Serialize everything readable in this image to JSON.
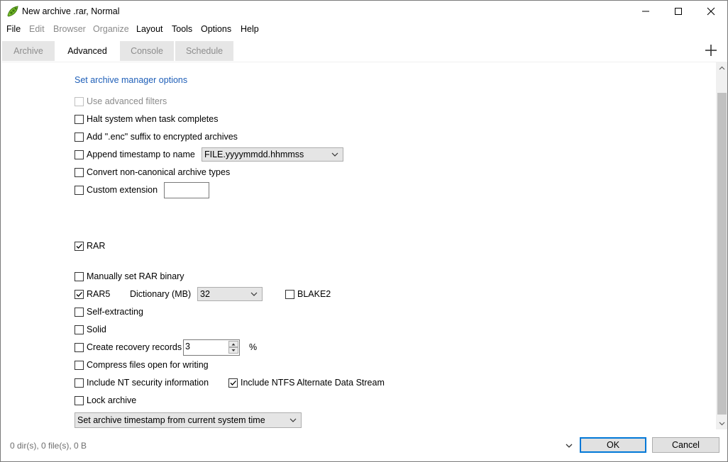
{
  "window": {
    "title": "New archive .rar, Normal"
  },
  "menu": [
    "File",
    "Edit",
    "Browser",
    "Organize",
    "Layout",
    "Tools",
    "Options",
    "Help"
  ],
  "tabs": [
    "Archive",
    "Advanced",
    "Console",
    "Schedule"
  ],
  "options": {
    "manager_link": "Set archive manager options",
    "use_advanced_filters": "Use advanced filters",
    "halt_system": "Halt system when task completes",
    "add_enc_suffix": "Add \".enc\" suffix to encrypted archives",
    "append_timestamp": "Append timestamp to name",
    "timestamp_format": "FILE.yyyymmdd.hhmmss",
    "convert_noncanonical": "Convert non-canonical archive types",
    "custom_extension": "Custom extension",
    "custom_extension_value": ""
  },
  "rar": {
    "rar_label": "RAR",
    "manual_binary": "Manually set RAR binary",
    "rar5": "RAR5",
    "dictionary_label": "Dictionary (MB)",
    "dictionary_value": "32",
    "blake2": "BLAKE2",
    "self_extracting": "Self-extracting",
    "solid": "Solid",
    "recovery_records": "Create recovery records",
    "recovery_value": "3",
    "percent": "%",
    "compress_open": "Compress files open for writing",
    "nt_security": "Include NT security information",
    "ntfs_ads": "Include NTFS Alternate Data Stream",
    "lock_archive": "Lock archive",
    "timestamp_mode": "Set archive timestamp from current system time"
  },
  "status": {
    "summary": "0 dir(s), 0 file(s), 0 B"
  },
  "buttons": {
    "ok": "OK",
    "cancel": "Cancel"
  },
  "colors": {
    "link": "#1f5fb8",
    "accent": "#0078d7",
    "app_icon": "#7cc02c"
  }
}
